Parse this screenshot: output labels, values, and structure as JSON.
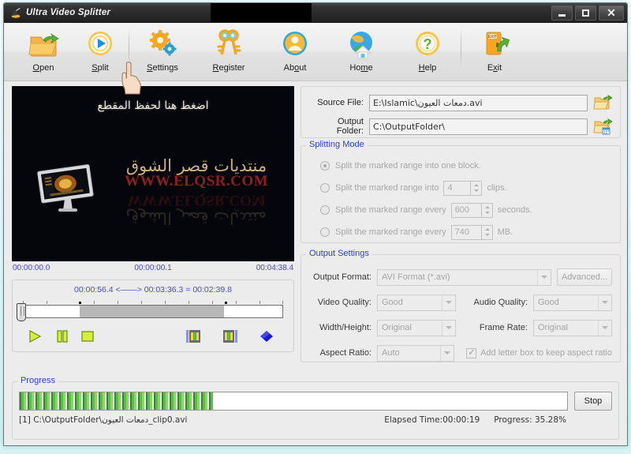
{
  "window": {
    "title": "Ultra Video Splitter",
    "icon": "app-icon",
    "minimize_label": "Minimize",
    "maximize_label": "Maximize",
    "close_label": "Close"
  },
  "toolbar": {
    "items": [
      {
        "label": "Open",
        "accel": "O",
        "icon": "open-folder-icon"
      },
      {
        "label": "Split",
        "accel": "S",
        "icon": "play-circle-icon"
      },
      {
        "label": "Settings",
        "accel": "S",
        "icon": "gears-icon"
      },
      {
        "label": "Register",
        "accel": "R",
        "icon": "keys-icon"
      },
      {
        "label": "About",
        "accel": "o",
        "icon": "person-circle-icon"
      },
      {
        "label": "Home",
        "accel": "m",
        "icon": "globe-house-icon"
      },
      {
        "label": "Help",
        "accel": "H",
        "icon": "question-circle-icon"
      },
      {
        "label": "Exit",
        "accel": "x",
        "icon": "exit-door-icon"
      }
    ]
  },
  "preview": {
    "overlay_top_text": "اضغط هنا لحفظ المقطع",
    "brand_arabic": "منتديات قصر الشوق",
    "brand_url": "WWW.ELQSR.COM"
  },
  "timeline": {
    "start": "00:00:00.0",
    "current": "00:00:00.1",
    "end": "00:04:38.4",
    "range_text": "00:00:56.4 <——> 00:03:36.3 = 00:02:39.8",
    "mark_in_pct": 21.5,
    "mark_out_pct": 77.5,
    "thumb_pct": 0,
    "controls": [
      {
        "name": "play-button",
        "icon": "play-icon"
      },
      {
        "name": "pause-button",
        "icon": "pause-icon"
      },
      {
        "name": "stop-button",
        "icon": "stop-icon"
      },
      {
        "name": "mark-start-button",
        "icon": "film-start-icon"
      },
      {
        "name": "mark-end-button",
        "icon": "film-end-icon"
      },
      {
        "name": "add-segment-button",
        "icon": "blue-diamond-icon"
      }
    ]
  },
  "files": {
    "source_label": "Source File:",
    "source_value": "E:\\Islamic\\دمعات العيون.avi",
    "output_label": "Output Folder:",
    "output_value": "C:\\OutputFolder\\",
    "browse_source_icon": "open-folder-icon",
    "browse_output_icon": "open-folder-calendar-icon"
  },
  "splitting_mode": {
    "title": "Splitting Mode",
    "options": [
      {
        "label_before": "Split the marked range into one block.",
        "selected": true,
        "value": null,
        "label_after": ""
      },
      {
        "label_before": "Split the marked range into",
        "selected": false,
        "value": "4",
        "label_after": "clips."
      },
      {
        "label_before": "Split the marked range every",
        "selected": false,
        "value": "600",
        "label_after": "seconds."
      },
      {
        "label_before": "Split the marked range every",
        "selected": false,
        "value": "740",
        "label_after": "MB."
      }
    ]
  },
  "output_settings": {
    "title": "Output Settings",
    "format_label": "Output Format:",
    "format_value": "AVI Format (*.avi)",
    "advanced_label": "Advanced...",
    "video_quality_label": "Video Quality:",
    "video_quality_value": "Good",
    "audio_quality_label": "Audio Quality:",
    "audio_quality_value": "Good",
    "width_height_label": "Width/Height:",
    "width_height_value": "Original",
    "frame_rate_label": "Frame Rate:",
    "frame_rate_value": "Original",
    "aspect_ratio_label": "Aspect Ratio:",
    "aspect_ratio_value": "Auto",
    "letterbox_label": "Add letter box to keep aspect ratio",
    "letterbox_checked": true
  },
  "progress": {
    "title": "Progress",
    "percent": 35.28,
    "fill_pct": 35.28,
    "stop_label": "Stop",
    "current_file": "[1] C:\\OutputFolder\\دمعات العيون_clip0.avi",
    "elapsed_label": "Elapsed Time:00:00:19",
    "progress_label": "Progress: 35.28%"
  },
  "colors": {
    "group_title": "#2b3fd0",
    "timeline_text": "#4a4ad2",
    "progress_green": "#5fbb4a",
    "window_bg": "#ececec",
    "titlebar": "#2a2a2a"
  }
}
